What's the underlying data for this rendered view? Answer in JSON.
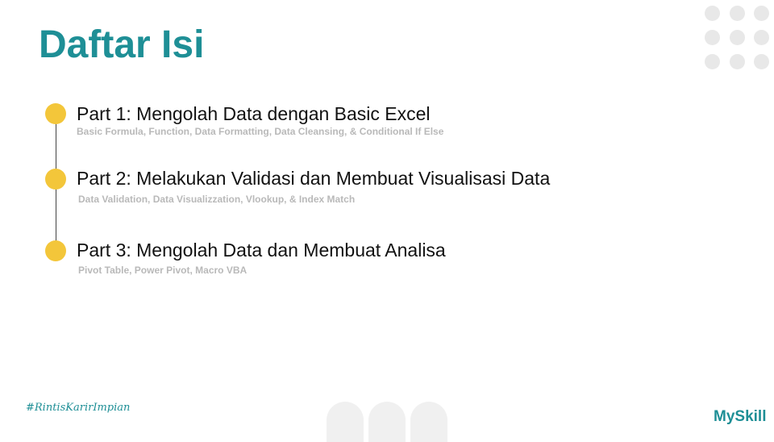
{
  "header": {
    "title": "Daftar Isi"
  },
  "parts": [
    {
      "title": "Part 1: Mengolah Data dengan Basic Excel",
      "subtitle": "Basic Formula,  Function,  Data Formatting,  Data Cleansing,  & Conditional  If Else"
    },
    {
      "title": "Part 2: Melakukan Validasi dan Membuat Visualisasi Data",
      "subtitle": "Data  Validation,  Data  Visualizzation,  Vlookup,  & Index Match"
    },
    {
      "title": "Part 3: Mengolah Data dan Membuat Analisa",
      "subtitle": "Pivot Table, Power Pivot, Macro VBA"
    }
  ],
  "footer": {
    "hashtag": "#RintisKarirImpian",
    "logo": "MySkill"
  },
  "colors": {
    "accent": "#1e8f96",
    "bullet": "#f3c63a",
    "subtitle": "#b9b9b9"
  }
}
